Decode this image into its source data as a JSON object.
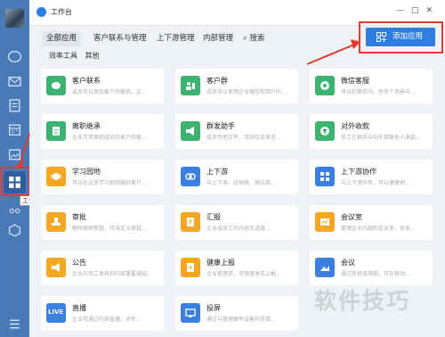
{
  "window": {
    "title": "工作台"
  },
  "tabs": [
    {
      "label": "全部应用",
      "active": true
    },
    {
      "label": "客户联系与管理",
      "active": false
    },
    {
      "label": "上下游管理",
      "active": false
    },
    {
      "label": "内部管理",
      "active": false
    },
    {
      "label": "搜索",
      "active": false
    }
  ],
  "subtabs": [
    "效率工具",
    "其他"
  ],
  "add_button": "添加应用",
  "tooltip": "工作台",
  "colors": {
    "sidebar": "#4a79b8",
    "accent": "#2f7de1",
    "annotation": "#e23a2e"
  },
  "apps": [
    {
      "name": "客户联系",
      "desc": "成员可以添加客户的微信，企...",
      "color": "#3cb371",
      "icon": "chat-icon"
    },
    {
      "name": "客户群",
      "desc": "成员可以使用企业微信和用户的...",
      "color": "#3cb371",
      "icon": "group-icon"
    },
    {
      "name": "微信客服",
      "desc": "可以在微信内、外多个场景中...",
      "color": "#3cb371",
      "icon": "service-icon"
    },
    {
      "name": "离职继承",
      "desc": "企业可将离职成员的客户和客...",
      "color": "#3cb371",
      "icon": "doc-icon"
    },
    {
      "name": "群发助手",
      "desc": "成员可把文件、活动信息发送...",
      "color": "#3cb371",
      "icon": "megaphone-icon"
    },
    {
      "name": "对外收款",
      "desc": "员工在聊天中向外部联系人收款...",
      "color": "#3cb371",
      "icon": "payment-icon"
    },
    {
      "name": "学习园地",
      "desc": "可以在这里学习如何做好客户...",
      "color": "#f5a623",
      "icon": "planet-icon"
    },
    {
      "name": "上下游",
      "desc": "与上下游、经销商、供应商...",
      "color": "#3d7fe0",
      "icon": "link-icon"
    },
    {
      "name": "上下游协作",
      "desc": "与上下游伙伴，可以便捷地...",
      "color": "#3d7fe0",
      "icon": "grid-icon"
    },
    {
      "name": "审批",
      "desc": "随时随地审批，可自定义审批...",
      "color": "#f5a623",
      "icon": "stamp-icon"
    },
    {
      "name": "汇报",
      "desc": "企业成员工作内容及进度...",
      "color": "#f5a623",
      "icon": "report-icon"
    },
    {
      "name": "会议室",
      "desc": "管理企业内部的会议室，员员...",
      "color": "#f5a623",
      "icon": "meeting-room-icon"
    },
    {
      "name": "公告",
      "desc": "企业向员工发布的内部重要通知...",
      "color": "#f5a623",
      "icon": "announce-icon"
    },
    {
      "name": "健康上报",
      "desc": "企业管理员，可快速发布上报...",
      "color": "#f5a623",
      "icon": "health-icon"
    },
    {
      "name": "会议",
      "desc": "通过手机或电脑，可在移动...",
      "color": "#3d7fe0",
      "icon": "meeting-icon"
    },
    {
      "name": "直播",
      "desc": "企业可通过内部直播，对外...",
      "color": "#3d7fe0",
      "icon": "live-icon"
    },
    {
      "name": "投屏",
      "desc": "通过与管理硬件设备的连接...",
      "color": "#3d7fe0",
      "icon": "cast-icon"
    }
  ],
  "live_badge": "LIVE",
  "watermark": "软件技巧"
}
